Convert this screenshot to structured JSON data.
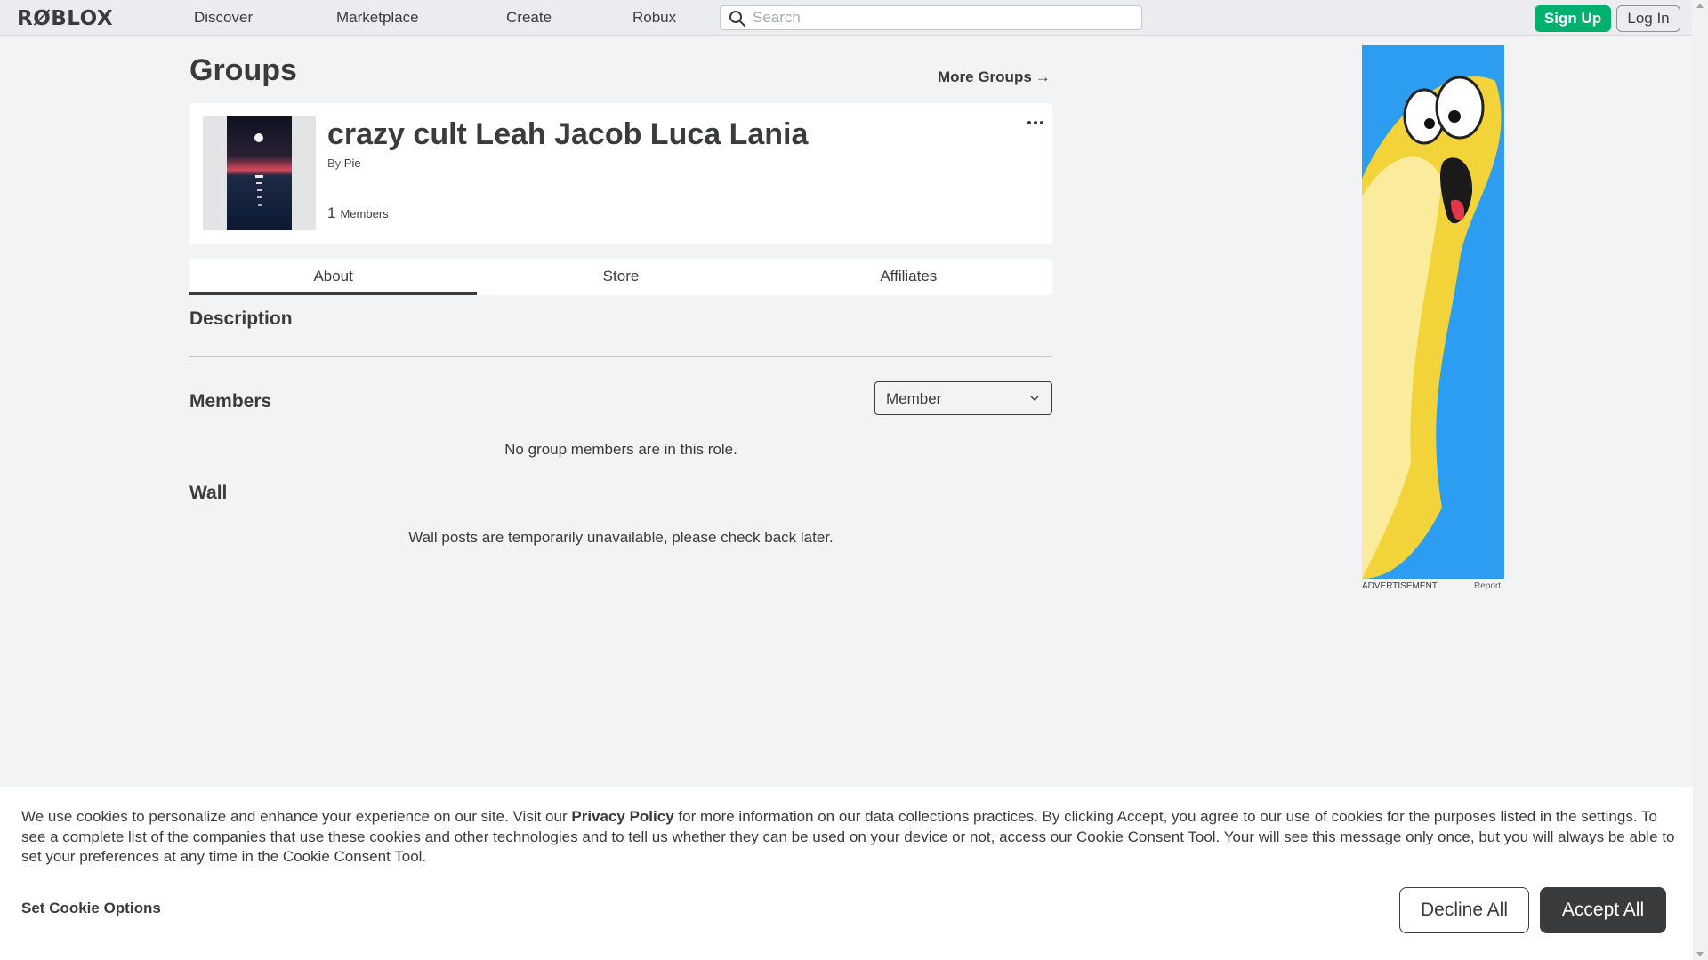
{
  "nav": {
    "logo": "RØBLOX",
    "links": [
      "Discover",
      "Marketplace",
      "Create",
      "Robux"
    ],
    "search_placeholder": "Search",
    "search_icon": "search-icon",
    "signup_label": "Sign Up",
    "login_label": "Log In",
    "accent_color": "#00b06f"
  },
  "page": {
    "title": "Groups",
    "more_groups_label": "More Groups",
    "more_groups_arrow": "→"
  },
  "group": {
    "name": "crazy cult Leah Jacob Luca Lania",
    "by_label": "By",
    "owner": "Pie",
    "member_count": "1",
    "members_label": "Members",
    "more_icon": "ellipsis-icon"
  },
  "tabs": [
    {
      "label": "About",
      "active": true
    },
    {
      "label": "Store",
      "active": false
    },
    {
      "label": "Affiliates",
      "active": false
    }
  ],
  "sections": {
    "description_heading": "Description",
    "members_heading": "Members",
    "role_select_value": "Member",
    "members_empty": "No group members are in this role.",
    "wall_heading": "Wall",
    "wall_empty": "Wall posts are temporarily unavailable, please check back later."
  },
  "ad": {
    "caption": "ADVERTISEMENT",
    "report_label": "Report"
  },
  "cookie": {
    "text_before": "We use cookies to personalize and enhance your experience on our site. Visit our ",
    "policy_link": "Privacy Policy",
    "text_after": " for more information on our data collections practices. By clicking Accept, you agree to our use of cookies for the purposes listed in the settings. To see a complete list of the companies that use these cookies and other technologies and to tell us whether they can be used on your device or not, access our Cookie Consent Tool. Your will see this message only once, but you will always be able to set your preferences at any time in the Cookie Consent Tool.",
    "set_options_label": "Set Cookie Options",
    "decline_label": "Decline All",
    "accept_label": "Accept All"
  }
}
